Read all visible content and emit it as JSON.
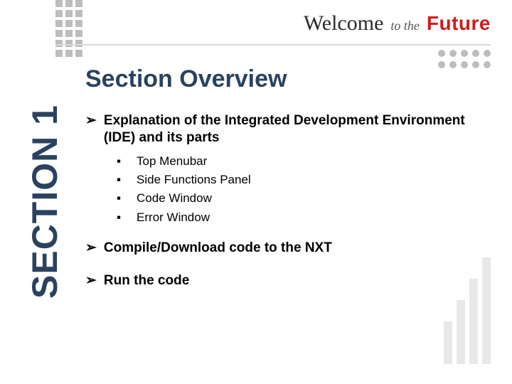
{
  "brand": {
    "welcome": "Welcome",
    "tothe": "to the",
    "future": "Future"
  },
  "section_label": "SECTION 1",
  "title": "Section Overview",
  "bullets": [
    {
      "text": "Explanation of the Integrated Development Environment (IDE) and its parts",
      "sub": [
        "Top Menubar",
        "Side Functions Panel",
        "Code Window",
        "Error Window"
      ]
    },
    {
      "text": "Compile/Download code to the NXT",
      "sub": []
    },
    {
      "text": "Run the code",
      "sub": []
    }
  ],
  "glyphs": {
    "l1": "➢",
    "l2": "▪"
  }
}
